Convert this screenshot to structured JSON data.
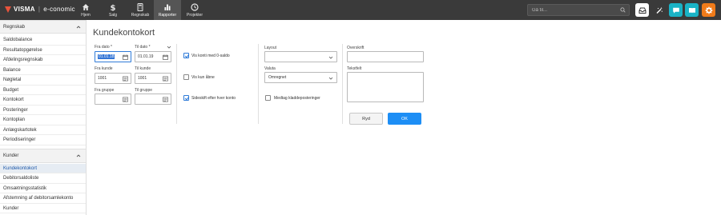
{
  "app": {
    "brand": "VISMA",
    "separator": "|",
    "product": "e-conomic"
  },
  "nav": {
    "items": [
      {
        "label": "Hjem",
        "icon": "home-icon"
      },
      {
        "label": "Salg",
        "icon": "dollar-icon"
      },
      {
        "label": "Regnskab",
        "icon": "calculator-icon"
      },
      {
        "label": "Rapporter",
        "icon": "bar-chart-icon",
        "active": true
      },
      {
        "label": "Projekter",
        "icon": "clock-icon"
      }
    ]
  },
  "search": {
    "placeholder": "Gå til..."
  },
  "top_buttons": [
    {
      "icon": "inbox-icon",
      "color": "#ffffff"
    },
    {
      "icon": "magic-wand-icon",
      "color": "#3a3a3a"
    },
    {
      "icon": "chat-icon",
      "color": "#1ab3c6"
    },
    {
      "icon": "book-icon",
      "color": "#1ab3c6"
    },
    {
      "icon": "gear-icon",
      "color": "#f07b1a"
    }
  ],
  "sidebar": {
    "sections": [
      {
        "title": "Regnskab",
        "items": [
          "Saldobalance",
          "Resultatopgørelse",
          "Afdelingsregnskab",
          "Balance",
          "Nøgletal",
          "Budget",
          "Kontokort",
          "Posteringer",
          "Kontoplan",
          "Anlægskartotek",
          "Periodiseringer"
        ]
      },
      {
        "title": "Kunder",
        "items": [
          "Kundekontokort",
          "Debitorsaldoliste",
          "Omsætningsstatistik",
          "Afstemning af debitorsamlekonto",
          "Kunder"
        ],
        "active_index": 0
      }
    ]
  },
  "page": {
    "title": "Kundekontokort"
  },
  "form": {
    "fra_dato_label": "Fra dato *",
    "fra_dato_value": "01.01.18",
    "til_dato_label": "Til dato *",
    "til_dato_value": "01.01.19",
    "fra_kunde_label": "Fra kunde",
    "fra_kunde_value": "1001",
    "til_kunde_label": "Til kunde",
    "til_kunde_value": "1001",
    "fra_gruppe_label": "Fra gruppe",
    "fra_gruppe_value": "",
    "til_gruppe_label": "Til gruppe",
    "til_gruppe_value": "",
    "check_vis_konti": {
      "label": "Vis konti med 0-saldo",
      "checked": true
    },
    "check_kun_aabne": {
      "label": "Vis kun åbne",
      "checked": false
    },
    "check_sideskift": {
      "label": "Sideskift efter hver konto",
      "checked": true
    },
    "layout_label": "Layout",
    "layout_value": "",
    "valuta_label": "Valuta",
    "valuta_value": "Omregnet",
    "check_kladde": {
      "label": "Medtag kladdeposteringer",
      "checked": false
    },
    "overskrift_label": "Overskrift",
    "overskrift_value": "",
    "tekstfelt_label": "Tekstfelt",
    "tekstfelt_value": "",
    "ryd_label": "Ryd",
    "ok_label": "OK"
  }
}
